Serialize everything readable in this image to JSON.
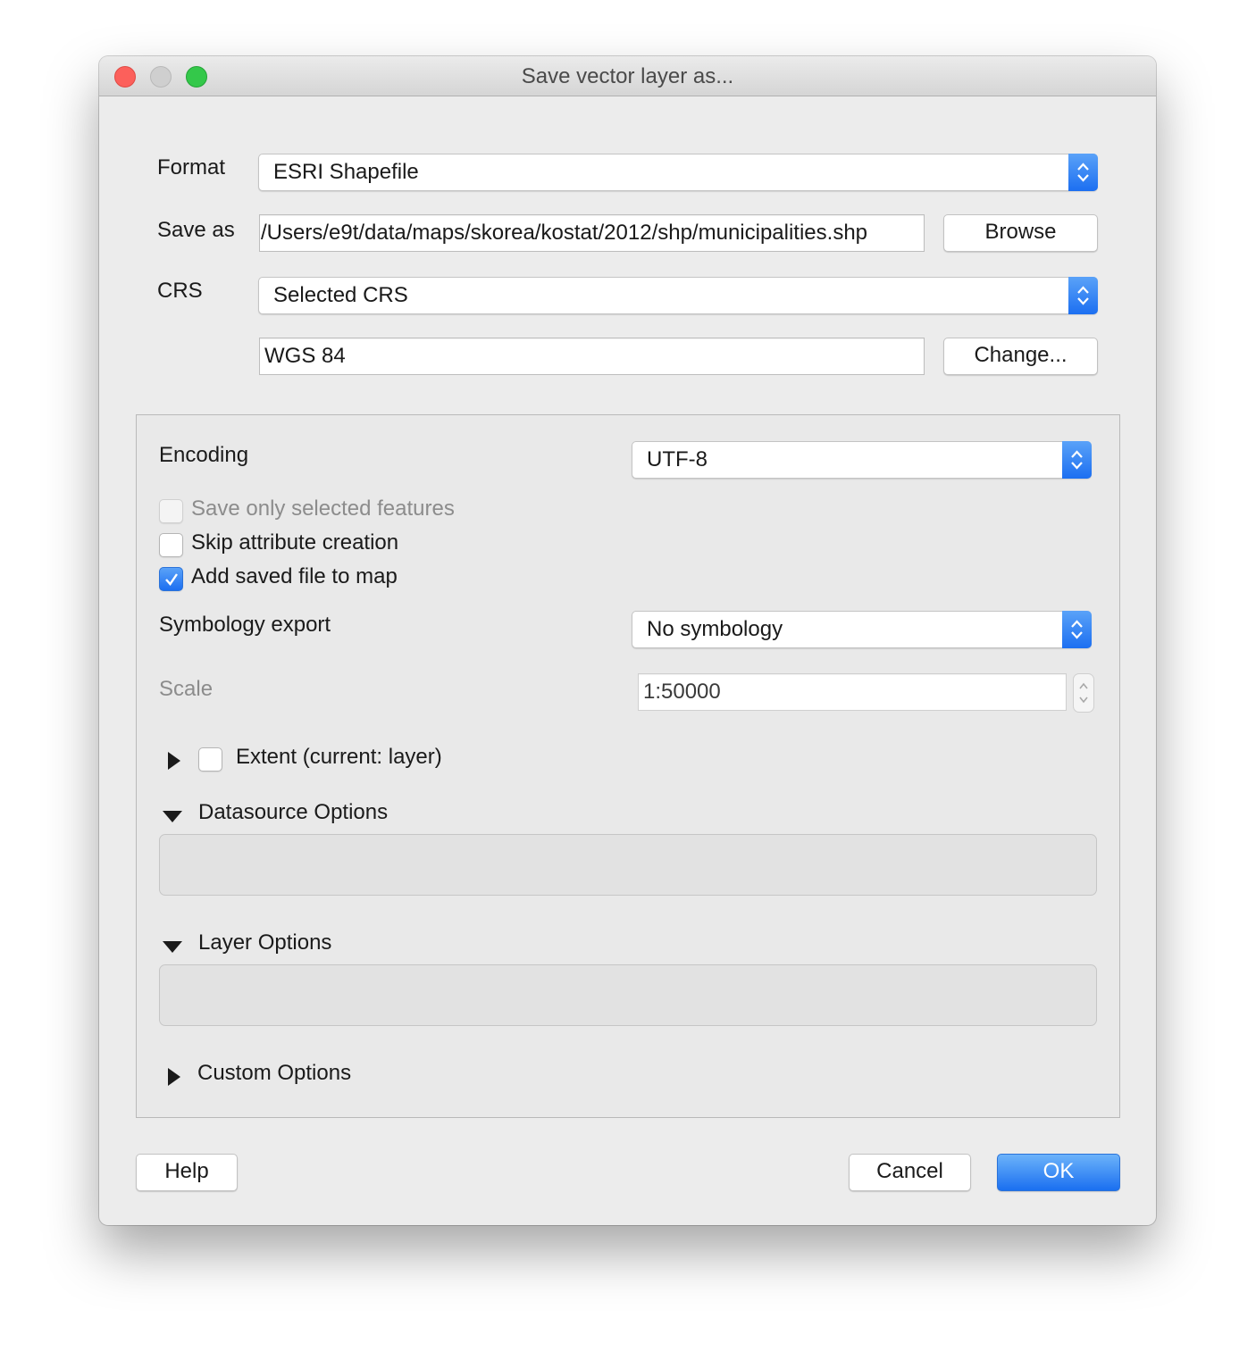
{
  "window": {
    "title": "Save vector layer as..."
  },
  "format": {
    "label": "Format",
    "value": "ESRI Shapefile"
  },
  "save_as": {
    "label": "Save as",
    "value": "/Users/e9t/data/maps/skorea/kostat/2012/shp/municipalities.shp",
    "browse_label": "Browse"
  },
  "crs": {
    "label": "CRS",
    "mode_value": "Selected CRS",
    "crs_value": "WGS 84",
    "change_label": "Change..."
  },
  "encoding": {
    "label": "Encoding",
    "value": "UTF-8"
  },
  "checkboxes": {
    "save_only_selected": {
      "label": "Save only selected features",
      "checked": false,
      "enabled": false
    },
    "skip_attribute_creation": {
      "label": "Skip attribute creation",
      "checked": false,
      "enabled": true
    },
    "add_saved_file": {
      "label": "Add saved file to map",
      "checked": true,
      "enabled": true
    }
  },
  "symbology": {
    "label": "Symbology export",
    "value": "No symbology"
  },
  "scale": {
    "label": "Scale",
    "value": "1:50000"
  },
  "sections": {
    "extent": {
      "label": "Extent (current: layer)",
      "expanded": false,
      "checked": false
    },
    "datasource_options": {
      "label": "Datasource Options",
      "expanded": true
    },
    "layer_options": {
      "label": "Layer Options",
      "expanded": true
    },
    "custom_options": {
      "label": "Custom Options",
      "expanded": false
    }
  },
  "buttons": {
    "help": "Help",
    "cancel": "Cancel",
    "ok": "OK"
  },
  "colors": {
    "accent": "#1c6ff1",
    "close": "#fc605b",
    "zoom": "#34c84a",
    "window_bg": "#ececec"
  }
}
